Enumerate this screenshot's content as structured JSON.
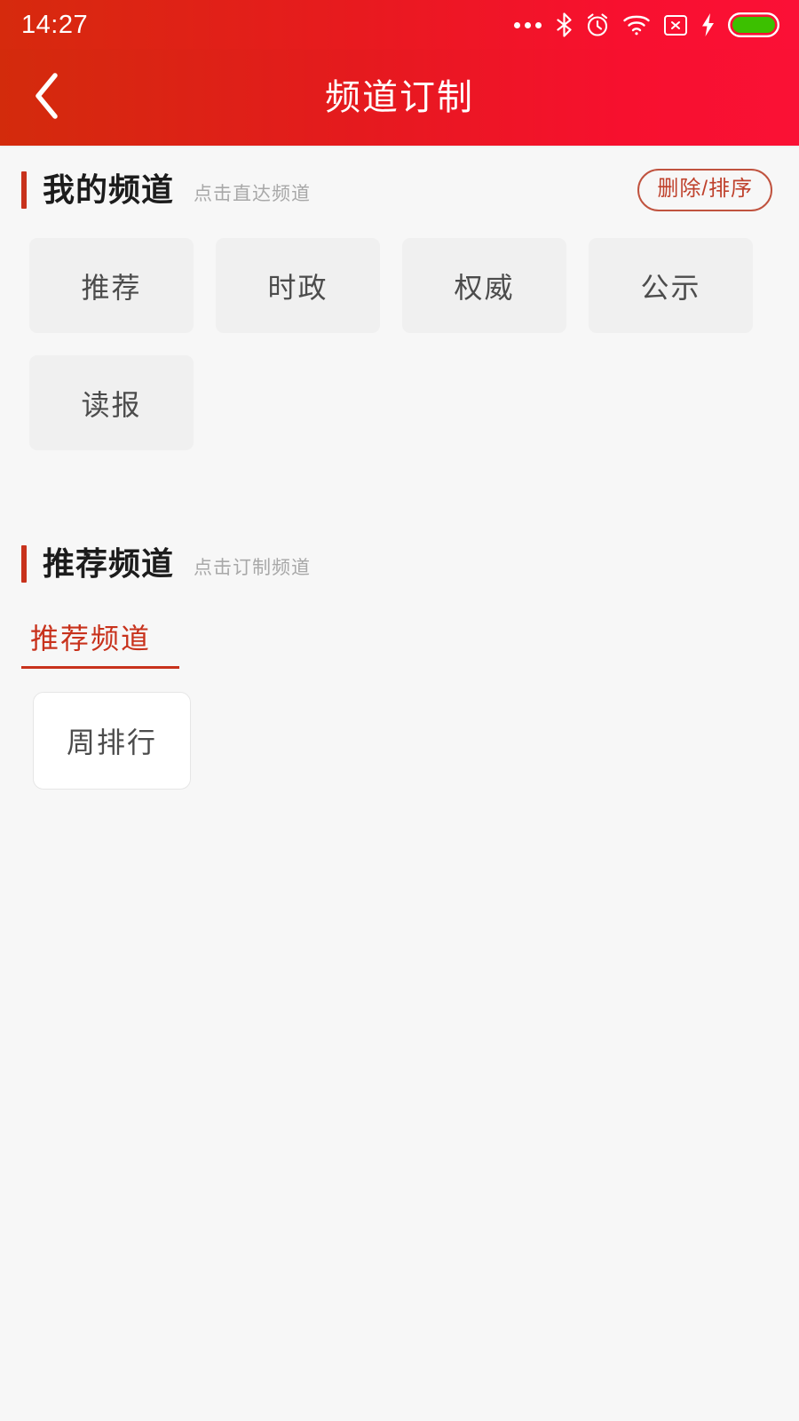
{
  "statusbar": {
    "time": "14:27",
    "icons": [
      {
        "name": "more-dots-icon"
      },
      {
        "name": "bluetooth-icon"
      },
      {
        "name": "alarm-clock-icon"
      },
      {
        "name": "wifi-icon"
      },
      {
        "name": "no-sim-icon"
      },
      {
        "name": "charging-bolt-icon"
      },
      {
        "name": "battery-icon"
      }
    ],
    "battery_color": "#3cc000"
  },
  "navbar": {
    "title": "频道订制",
    "back_icon": "chevron-left-icon",
    "gradient_from": "#d32b0c",
    "gradient_to": "#fa1135"
  },
  "my_channels": {
    "title": "我的频道",
    "subtitle": "点击直达频道",
    "action_label": "删除/排序",
    "accent_color": "#c8321c",
    "chips": [
      {
        "label": "推荐"
      },
      {
        "label": "时政"
      },
      {
        "label": "权威"
      },
      {
        "label": "公示"
      },
      {
        "label": "读报"
      }
    ]
  },
  "recommend_channels": {
    "title": "推荐频道",
    "subtitle": "点击订制频道",
    "accent_color": "#c8321c",
    "tabs": [
      {
        "label": "推荐频道",
        "active": true
      }
    ],
    "cards": [
      {
        "label": "周排行"
      }
    ]
  },
  "theme": {
    "page_background": "#f7f7f7",
    "chip_background": "#f0f0f0",
    "brand_red": "#c8321c"
  }
}
